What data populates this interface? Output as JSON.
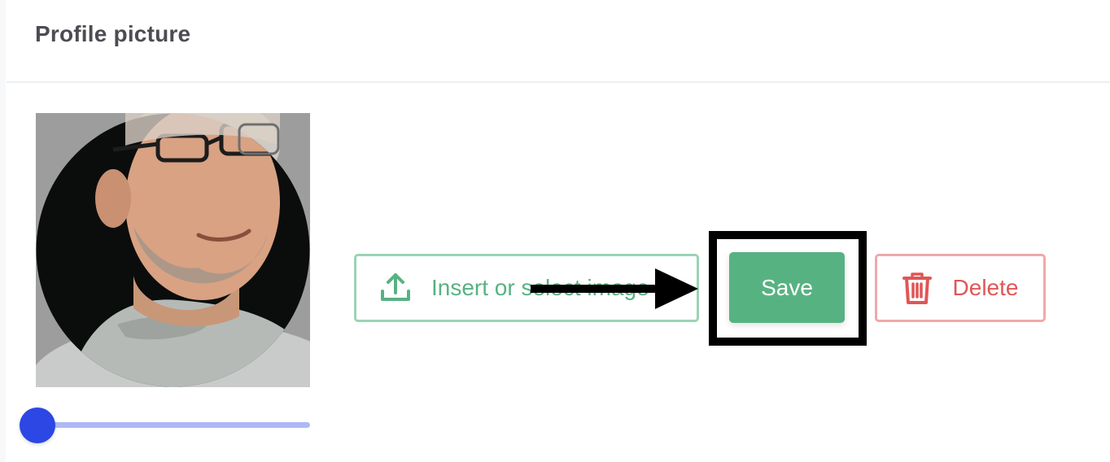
{
  "header": {
    "title": "Profile picture"
  },
  "avatar": {
    "description_icon": "profile-photo"
  },
  "slider": {
    "zoom_fraction": 0.0
  },
  "actions": {
    "insert_label": "Insert or select image",
    "save_label": "Save",
    "delete_label": "Delete"
  },
  "icons": {
    "upload": "upload-icon",
    "trash": "trash-icon"
  },
  "colors": {
    "primary_green": "#57b282",
    "insert_border": "#9bd3b5",
    "delete_red": "#e05656",
    "delete_border": "#efa9a9",
    "slider_thumb": "#2c47e3",
    "slider_track": "#aebaf5",
    "annotation": "#000000"
  }
}
